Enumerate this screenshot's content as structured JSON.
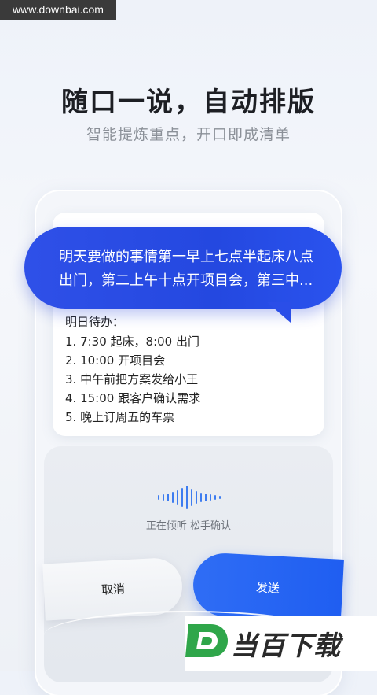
{
  "watermark": "www.downbai.com",
  "header": {
    "title": "随口一说，自动排版",
    "subtitle": "智能提炼重点，开口即成清单"
  },
  "bubble": {
    "line1": "明天要做的事情第一早上七点半起床八点",
    "line2": "出门，第二上午十点开项目会，第三中..."
  },
  "note": {
    "title": "明日待办：",
    "items": [
      "1. 7:30 起床，8:00 出门",
      "2. 10:00 开项目会",
      "3. 中午前把方案发给小王",
      "4. 15:00 跟客户确认需求",
      "5. 晚上订周五的车票"
    ]
  },
  "voice": {
    "status": "正在倾听 松手确认"
  },
  "buttons": {
    "cancel": "取消",
    "send": "发送"
  },
  "brand": {
    "logo_letter": "D",
    "name": "当百下载"
  },
  "colors": {
    "accent_blue": "#2448e0",
    "send_blue": "#1f5ef1",
    "logo_green": "#2fa64a"
  },
  "icons": {
    "wave": "voice-waveform-icon"
  }
}
